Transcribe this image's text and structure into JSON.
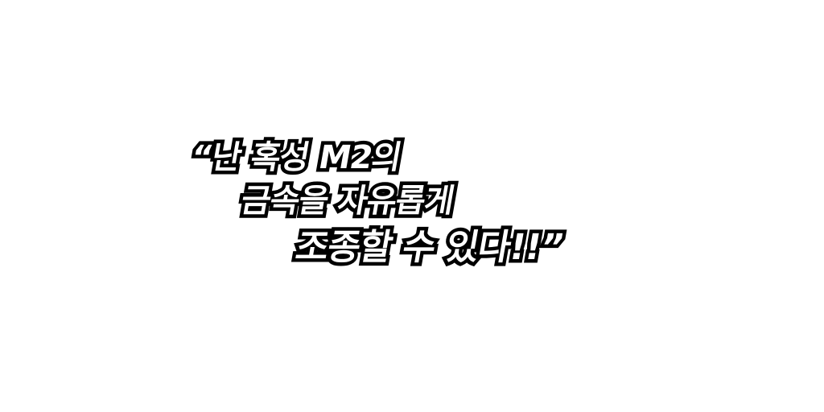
{
  "caption": {
    "lines": [
      "“난 혹성 M2의",
      "금속을 자유롭게",
      "조종할 수 있다!!”"
    ]
  }
}
